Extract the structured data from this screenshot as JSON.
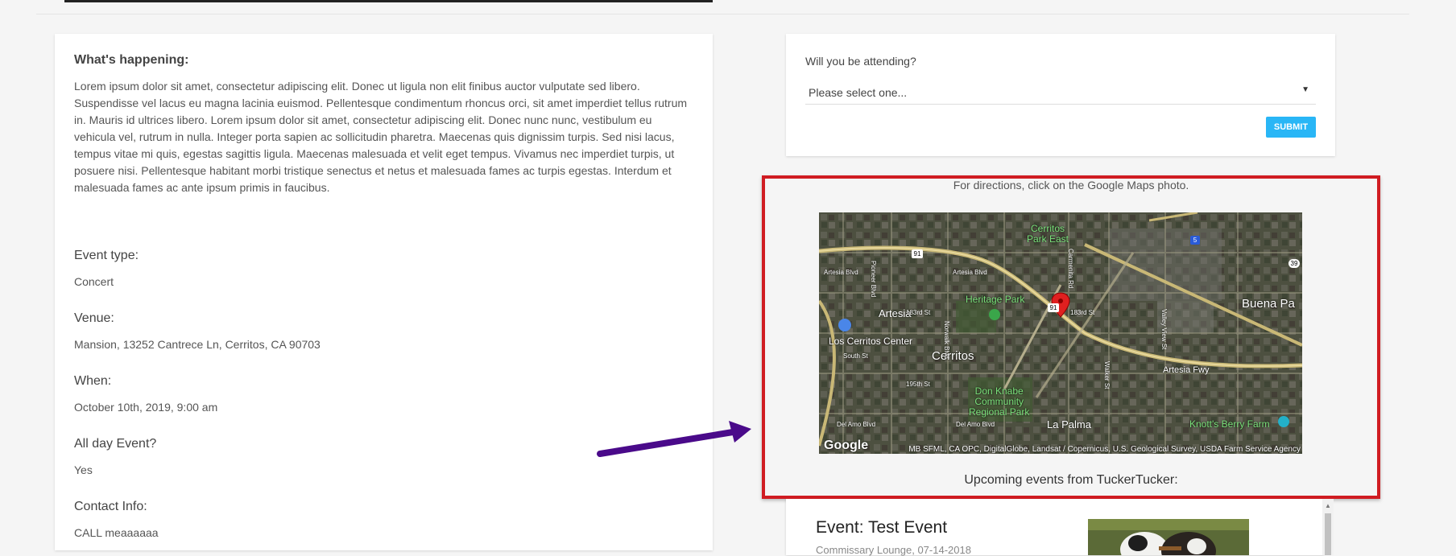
{
  "details": {
    "happening_label": "What's happening:",
    "description": "Lorem ipsum dolor sit amet, consectetur adipiscing elit. Donec ut ligula non elit finibus auctor vulputate sed libero. Suspendisse vel lacus eu magna lacinia euismod. Pellentesque condimentum rhoncus orci, sit amet imperdiet tellus rutrum in. Mauris id ultrices libero. Lorem ipsum dolor sit amet, consectetur adipiscing elit. Donec nunc nunc, vestibulum eu vehicula vel, rutrum in nulla. Integer porta sapien ac sollicitudin pharetra. Maecenas quis dignissim turpis. Sed nisi lacus, tempus vitae mi quis, egestas sagittis ligula. Maecenas malesuada et velit eget tempus. Vivamus nec imperdiet turpis, ut posuere nisi. Pellentesque habitant morbi tristique senectus et netus et malesuada fames ac turpis egestas. Interdum et malesuada fames ac ante ipsum primis in faucibus.",
    "event_type_label": "Event type:",
    "event_type": "Concert",
    "venue_label": "Venue:",
    "venue": "Mansion, 13252 Cantrece Ln, Cerritos, CA 90703",
    "when_label": "When:",
    "when": "October 10th, 2019, 9:00 am",
    "all_day_label": "All day Event?",
    "all_day": "Yes",
    "contact_label": "Contact Info:",
    "contact": "CALL meaaaaaa"
  },
  "rsvp": {
    "question": "Will you be attending?",
    "selected": "Please select one...",
    "submit_label": "SUBMIT"
  },
  "map": {
    "directions_text": "For directions, click on the Google Maps photo.",
    "logo": "Google",
    "attribution": "MB SFML, CA OPC, DigitalGlobe, Landsat / Copernicus, U.S. Geological Survey, USDA Farm Service Agency",
    "labels": {
      "cerritos_park_east_1": "Cerritos",
      "cerritos_park_east_2": "Park East",
      "heritage_park": "Heritage Park",
      "artesia": "Artesia",
      "los_cerritos_center": "Los Cerritos Center",
      "cerritos": "Cerritos",
      "buena_park": "Buena Pa",
      "artesia_fwy": "Artesia Fwy",
      "don_knabe_1": "Don Knabe",
      "don_knabe_2": "Community",
      "don_knabe_3": "Regional Park",
      "la_palma": "La Palma",
      "knotts": "Knott's Berry Farm",
      "artesia_blvd_1": "Artesia Blvd",
      "artesia_blvd_2": "Artesia Blvd",
      "st_183_1": "183rd St",
      "st_183_2": "183rd St",
      "south_st": "South St",
      "st_195": "195th St",
      "del_amo_1": "Del Amo Blvd",
      "del_amo_2": "Del Amo Blvd",
      "pioneer": "Pioneer Blvd",
      "norwalk": "Norwalk Blvd",
      "carmenita": "Carmenita Rd",
      "valley_view": "Valley View St",
      "walker": "Walker St",
      "shield_91a": "91",
      "shield_91b": "91",
      "shield_5": "5",
      "shield_39": "39"
    }
  },
  "upcoming": {
    "title": "Upcoming events from TuckerTucker:",
    "events": [
      {
        "title": "Event: Test Event",
        "subtitle": "Commissary Lounge, 07-14-2018"
      }
    ]
  },
  "colors": {
    "highlight_border": "#d01c22",
    "annotation_arrow": "#4a0a8a",
    "submit_button": "#29b6f6",
    "map_pin": "#e02020",
    "park_label": "#7be07b"
  }
}
